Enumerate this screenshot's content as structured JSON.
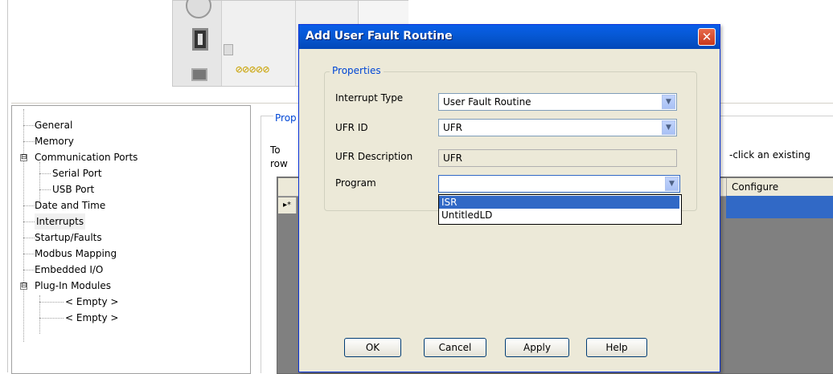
{
  "dialog": {
    "title": "Add User Fault Routine",
    "close_glyph": "✕",
    "group_title": "Properties",
    "fields": {
      "interrupt_type": {
        "label": "Interrupt Type",
        "value": "User Fault Routine"
      },
      "ufr_id": {
        "label": "UFR ID",
        "value": "UFR"
      },
      "ufr_description": {
        "label": "UFR Description",
        "value": "UFR"
      },
      "program": {
        "label": "Program",
        "value": ""
      }
    },
    "program_options": [
      "ISR",
      "UntitledLD"
    ],
    "buttons": {
      "ok": "OK",
      "cancel": "Cancel",
      "apply": "Apply",
      "help": "Help"
    }
  },
  "tree": {
    "items": [
      "General",
      "Memory",
      "Communication Ports",
      "Serial Port",
      "USB Port",
      "Date and Time",
      "Interrupts",
      "Startup/Faults",
      "Modbus Mapping",
      "Embedded I/O",
      "Plug-In Modules",
      "< Empty >",
      "< Empty >"
    ],
    "expanders": [
      "⊟",
      "⊟"
    ]
  },
  "background_panel": {
    "legend": "Prop",
    "hint_left_line1": "To",
    "hint_left_line2": "row",
    "hint_right": "-click an existing",
    "grid_header_configure": "Configure",
    "row_indicator": "▸*"
  },
  "device": {
    "terminals": "⊘⊘⊘⊘⊘"
  },
  "colors": {
    "title_bar": "#0a5ee8",
    "selection": "#3169c6",
    "dialog_bg": "#ece9d8",
    "legend_blue": "#0046d5"
  },
  "icons": {
    "dropdown_arrow": "▼"
  }
}
